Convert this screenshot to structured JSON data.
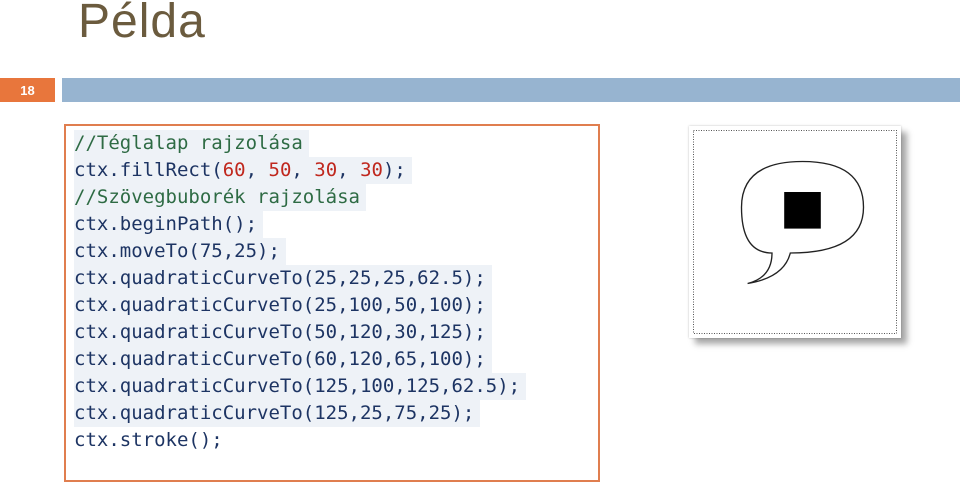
{
  "slide": {
    "title": "Példa",
    "number": "18"
  },
  "code": {
    "lines": [
      [
        {
          "t": "//Téglalap rajzolása",
          "c": "comment"
        }
      ],
      [
        {
          "t": "ctx.fillRect(",
          "c": "plain"
        },
        {
          "t": "60",
          "c": "num"
        },
        {
          "t": ", ",
          "c": "plain"
        },
        {
          "t": "50",
          "c": "num"
        },
        {
          "t": ", ",
          "c": "plain"
        },
        {
          "t": "30",
          "c": "num"
        },
        {
          "t": ", ",
          "c": "plain"
        },
        {
          "t": "30",
          "c": "num"
        },
        {
          "t": ");",
          "c": "plain"
        }
      ],
      [
        {
          "t": "//Szövegbuborék rajzolása",
          "c": "comment"
        }
      ],
      [
        {
          "t": "ctx.beginPath();",
          "c": "plain"
        }
      ],
      [
        {
          "t": "ctx.moveTo(75,25);",
          "c": "plain"
        }
      ],
      [
        {
          "t": "ctx.quadraticCurveTo(25,25,25,62.5);",
          "c": "plain"
        }
      ],
      [
        {
          "t": "ctx.quadraticCurveTo(25,100,50,100);",
          "c": "plain"
        }
      ],
      [
        {
          "t": "ctx.quadraticCurveTo(50,120,30,125);",
          "c": "plain"
        }
      ],
      [
        {
          "t": "ctx.quadraticCurveTo(60,120,65,100);",
          "c": "plain"
        }
      ],
      [
        {
          "t": "ctx.quadraticCurveTo(125,100,125,62.5);",
          "c": "plain"
        }
      ],
      [
        {
          "t": "ctx.quadraticCurveTo(125,25,75,25);",
          "c": "plain"
        }
      ],
      [
        {
          "t": "ctx.stroke();",
          "c": "plain"
        }
      ]
    ]
  },
  "colors": {
    "title": "#6b5b3e",
    "accent": "#e8763c",
    "rule": "#97b4d0",
    "code_text": "#1d3463",
    "comment": "#2e6b44",
    "number": "#c0281e"
  },
  "preview": {
    "shapes": [
      "filled-square",
      "speech-bubble"
    ]
  }
}
